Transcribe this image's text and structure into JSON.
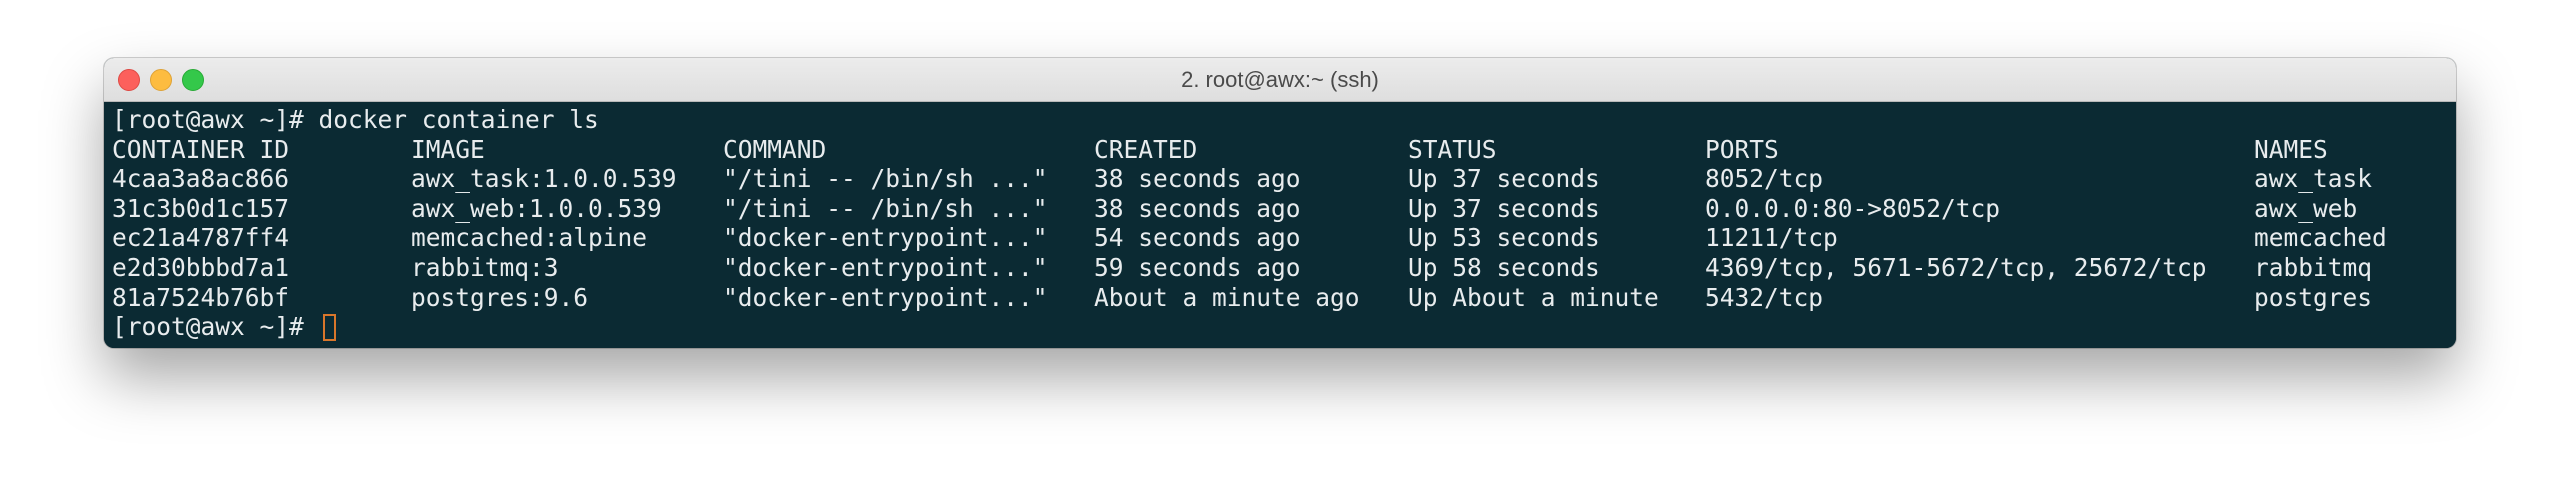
{
  "window": {
    "title": "2. root@awx:~ (ssh)"
  },
  "terminal": {
    "prompt_line": "[root@awx ~]# docker container ls",
    "headers": {
      "id": "CONTAINER ID",
      "image": "IMAGE",
      "command": "COMMAND",
      "created": "CREATED",
      "status": "STATUS",
      "ports": "PORTS",
      "names": "NAMES"
    },
    "rows": [
      {
        "id": "4caa3a8ac866",
        "image": "awx_task:1.0.0.539",
        "command": "\"/tini -- /bin/sh ...\"",
        "created": "38 seconds ago",
        "status": "Up 37 seconds",
        "ports": "8052/tcp",
        "names": "awx_task"
      },
      {
        "id": "31c3b0d1c157",
        "image": "awx_web:1.0.0.539",
        "command": "\"/tini -- /bin/sh ...\"",
        "created": "38 seconds ago",
        "status": "Up 37 seconds",
        "ports": "0.0.0.0:80->8052/tcp",
        "names": "awx_web"
      },
      {
        "id": "ec21a4787ff4",
        "image": "memcached:alpine",
        "command": "\"docker-entrypoint...\"",
        "created": "54 seconds ago",
        "status": "Up 53 seconds",
        "ports": "11211/tcp",
        "names": "memcached"
      },
      {
        "id": "e2d30bbbd7a1",
        "image": "rabbitmq:3",
        "command": "\"docker-entrypoint...\"",
        "created": "59 seconds ago",
        "status": "Up 58 seconds",
        "ports": "4369/tcp, 5671-5672/tcp, 25672/tcp",
        "names": "rabbitmq"
      },
      {
        "id": "81a7524b76bf",
        "image": "postgres:9.6",
        "command": "\"docker-entrypoint...\"",
        "created": "About a minute ago",
        "status": "Up About a minute",
        "ports": "5432/tcp",
        "names": "postgres"
      }
    ],
    "final_prompt": "[root@awx ~]# "
  },
  "colors": {
    "terminal_bg": "#0b2a33",
    "terminal_fg": "#e8ecee",
    "cursor": "#d9762b",
    "close": "#fc605c",
    "minimize": "#fdbc40",
    "maximize": "#34c84a"
  },
  "icons": [
    "close-button",
    "minimize-button",
    "maximize-button",
    "cursor-block"
  ]
}
